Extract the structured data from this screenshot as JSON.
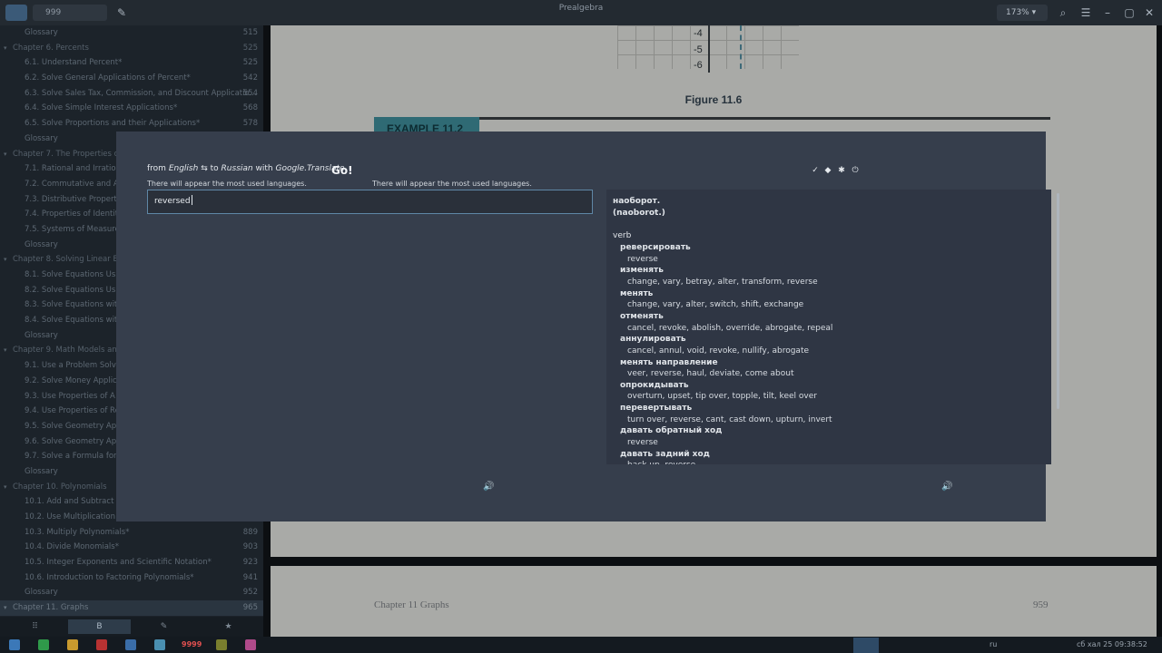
{
  "topbar": {
    "search_placeholder": "999",
    "title": "Prealgebra",
    "zoom": "173%"
  },
  "sidebar": {
    "items": [
      {
        "kind": "item",
        "label": "Glossary",
        "page": "515"
      },
      {
        "kind": "chapter",
        "label": "Chapter 6. Percents",
        "page": "525"
      },
      {
        "kind": "item",
        "label": "6.1. Understand Percent*",
        "page": "525"
      },
      {
        "kind": "item",
        "label": "6.2. Solve General Applications of Percent*",
        "page": "542"
      },
      {
        "kind": "item",
        "label": "6.3. Solve Sales Tax, Commission, and Discount Applicatio...",
        "page": "554"
      },
      {
        "kind": "item",
        "label": "6.4. Solve Simple Interest Applications*",
        "page": "568"
      },
      {
        "kind": "item",
        "label": "6.5. Solve Proportions and their Applications*",
        "page": "578"
      },
      {
        "kind": "item",
        "label": "Glossary",
        "page": ""
      },
      {
        "kind": "chapter",
        "label": "Chapter 7. The Properties o",
        "page": ""
      },
      {
        "kind": "item",
        "label": "7.1. Rational and Irration",
        "page": ""
      },
      {
        "kind": "item",
        "label": "7.2. Commutative and As",
        "page": ""
      },
      {
        "kind": "item",
        "label": "7.3. Distributive Propert",
        "page": ""
      },
      {
        "kind": "item",
        "label": "7.4. Properties of Identit",
        "page": ""
      },
      {
        "kind": "item",
        "label": "7.5. Systems of Measure",
        "page": ""
      },
      {
        "kind": "item",
        "label": "Glossary",
        "page": ""
      },
      {
        "kind": "chapter",
        "label": "Chapter 8. Solving Linear Eq",
        "page": ""
      },
      {
        "kind": "item",
        "label": "8.1. Solve Equations Usin",
        "page": ""
      },
      {
        "kind": "item",
        "label": "8.2. Solve Equations Usin",
        "page": ""
      },
      {
        "kind": "item",
        "label": "8.3. Solve Equations with",
        "page": ""
      },
      {
        "kind": "item",
        "label": "8.4. Solve Equations with",
        "page": ""
      },
      {
        "kind": "item",
        "label": "Glossary",
        "page": ""
      },
      {
        "kind": "chapter",
        "label": "Chapter 9. Math Models and",
        "page": ""
      },
      {
        "kind": "item",
        "label": "9.1. Use a Problem Solvi",
        "page": ""
      },
      {
        "kind": "item",
        "label": "9.2. Solve Money Applica",
        "page": ""
      },
      {
        "kind": "item",
        "label": "9.3. Use Properties of A",
        "page": ""
      },
      {
        "kind": "item",
        "label": "9.4. Use Properties of Re",
        "page": ""
      },
      {
        "kind": "item",
        "label": "9.5. Solve Geometry App",
        "page": ""
      },
      {
        "kind": "item",
        "label": "9.6. Solve Geometry App",
        "page": ""
      },
      {
        "kind": "item",
        "label": "9.7. Solve a Formula for",
        "page": ""
      },
      {
        "kind": "item",
        "label": "Glossary",
        "page": ""
      },
      {
        "kind": "chapter",
        "label": "Chapter 10. Polynomials",
        "page": ""
      },
      {
        "kind": "item",
        "label": "10.1. Add and Subtract P",
        "page": ""
      },
      {
        "kind": "item",
        "label": "10.2. Use Multiplication P",
        "page": ""
      },
      {
        "kind": "item",
        "label": "10.3. Multiply Polynomials*",
        "page": "889"
      },
      {
        "kind": "item",
        "label": "10.4. Divide Monomials*",
        "page": "903"
      },
      {
        "kind": "item",
        "label": "10.5. Integer Exponents and Scientific Notation*",
        "page": "923"
      },
      {
        "kind": "item",
        "label": "10.6. Introduction to Factoring Polynomials*",
        "page": "941"
      },
      {
        "kind": "item",
        "label": "Glossary",
        "page": "952"
      },
      {
        "kind": "chapter",
        "label": "Chapter 11. Graphs",
        "page": "965"
      }
    ],
    "tabs": [
      "⠿",
      "B",
      "✎",
      "★"
    ]
  },
  "document": {
    "y_ticks": [
      "-4",
      "-5",
      "-6"
    ],
    "figure_caption": "Figure 11.6",
    "example_label": "EXAMPLE 11.2",
    "footer_left": "Chapter 11 Graphs",
    "footer_right": "959"
  },
  "translator": {
    "from_prefix": "from",
    "source_lang": "English",
    "swap_symbol": "⇆",
    "to_prefix": "to",
    "target_lang": "Russian",
    "with_prefix": "with",
    "engine": "Google.Translate",
    "go_label": "Go!",
    "hint_left": "There will appear the most used languages.",
    "hint_right": "There will appear the most used languages.",
    "input_text": "reversed",
    "result_headline": "наоборот.",
    "result_translit": "(naoborot.)",
    "part_of_speech": "verb",
    "entries": [
      {
        "word": "реверсировать",
        "synonyms": "reverse"
      },
      {
        "word": "изменять",
        "synonyms": "change, vary, betray, alter, transform, reverse"
      },
      {
        "word": "менять",
        "synonyms": "change, vary, alter, switch, shift, exchange"
      },
      {
        "word": "отменять",
        "synonyms": "cancel, revoke, abolish, override, abrogate, repeal"
      },
      {
        "word": "аннулировать",
        "synonyms": "cancel, annul, void, revoke, nullify, abrogate"
      },
      {
        "word": "менять направление",
        "synonyms": "veer, reverse, haul, deviate, come about"
      },
      {
        "word": "опрокидывать",
        "synonyms": "overturn, upset, tip over, topple, tilt, keel over"
      },
      {
        "word": "перевертывать",
        "synonyms": "turn over, reverse, cant, cast down, upturn, invert"
      },
      {
        "word": "давать обратный ход",
        "synonyms": "reverse"
      },
      {
        "word": "давать задний ход",
        "synonyms": "back up, reverse"
      }
    ]
  },
  "taskbar": {
    "badge": "9999",
    "lang": "ru",
    "clock": "сб хал 25  09:38:52"
  }
}
